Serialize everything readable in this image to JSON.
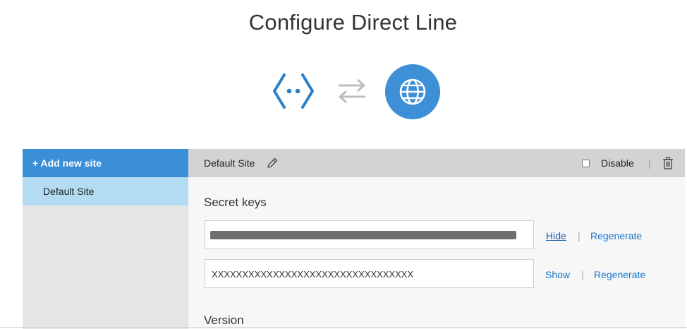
{
  "page": {
    "title": "Configure Direct Line"
  },
  "colors": {
    "accent": "#3a8fd6",
    "selected": "#b3dcf2",
    "link": "#1a73c9"
  },
  "icons": {
    "bot": "bot-code-icon",
    "arrows": "exchange-arrows-icon",
    "globe": "globe-icon"
  },
  "sidebar": {
    "add_label": "+ Add new site",
    "items": [
      {
        "label": "Default Site",
        "selected": true
      }
    ]
  },
  "header": {
    "site_name": "Default Site",
    "disable_label": "Disable",
    "disable_checked": false,
    "separator": "|"
  },
  "secret_keys": {
    "title": "Secret keys",
    "key1": {
      "value_masked": true,
      "toggle_label": "Hide",
      "regenerate_label": "Regenerate"
    },
    "key2": {
      "value": "XXXXXXXXXXXXXXXXXXXXXXXXXXXXXXXXX",
      "toggle_label": "Show",
      "regenerate_label": "Regenerate"
    },
    "separator": "|"
  },
  "version": {
    "title": "Version"
  }
}
